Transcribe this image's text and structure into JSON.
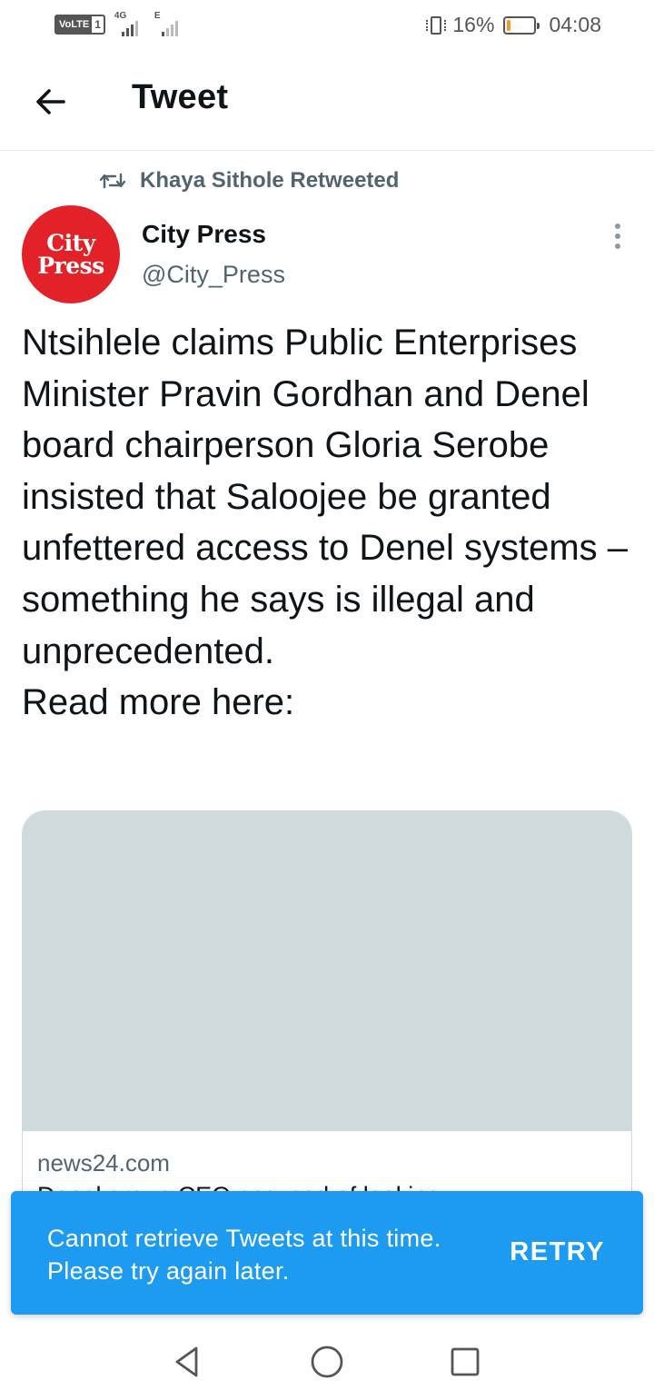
{
  "status_bar": {
    "volte_label": "VoLTE",
    "sim_slot": "1",
    "network_1": "4G",
    "network_2": "E",
    "battery_percent": "16%",
    "battery_level": 0.16,
    "battery_color": "#f0a020",
    "time": "04:08"
  },
  "header": {
    "title": "Tweet",
    "back_icon": "arrow-left-icon"
  },
  "tweet": {
    "retweeted_by": "Khaya Sithole Retweeted",
    "author_name": "City Press",
    "author_handle": "@City_Press",
    "avatar_line1": "City",
    "avatar_line2": "Press",
    "avatar_color": "#e22128",
    "text": "Ntsihlele claims Public Enterprises Minister Pravin Gordhan and Denel board chairperson Gloria Serobe insisted that Saloojee be granted unfettered access to Denel systems – something he says is illegal and unprecedented.\nRead more here:",
    "card": {
      "domain": "news24.com",
      "headline": "Denel group CEO accused of looking"
    }
  },
  "toast": {
    "message": "Cannot retrieve Tweets at this time. Please try again later.",
    "action": "RETRY",
    "color": "#1d9bf0"
  },
  "nav_bar": {
    "buttons": [
      "back-triangle-icon",
      "home-circle-icon",
      "recents-square-icon"
    ]
  }
}
